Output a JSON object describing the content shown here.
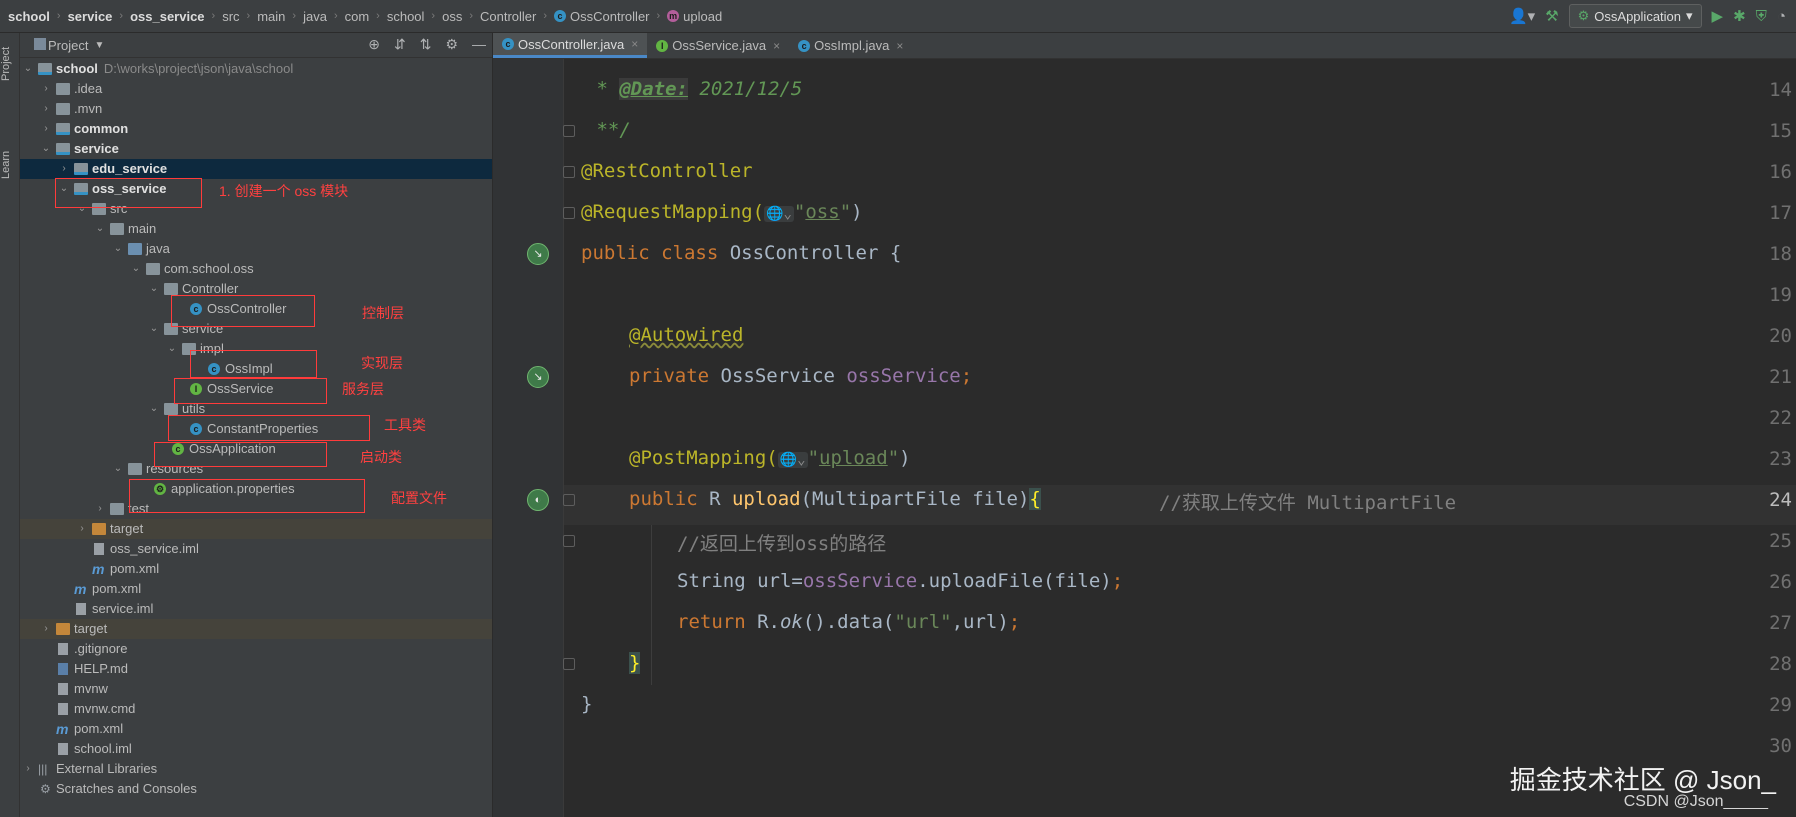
{
  "breadcrumb": [
    {
      "label": "school",
      "bold": true
    },
    {
      "label": "service",
      "bold": true
    },
    {
      "label": "oss_service",
      "bold": true
    },
    {
      "label": "src"
    },
    {
      "label": "main"
    },
    {
      "label": "java"
    },
    {
      "label": "com"
    },
    {
      "label": "school"
    },
    {
      "label": "oss"
    },
    {
      "label": "Controller"
    },
    {
      "label": "OssController",
      "icon": "class-icon"
    },
    {
      "label": "upload",
      "icon": "method-icon"
    }
  ],
  "run_config": {
    "label": "OssApplication"
  },
  "left_strip": {
    "project": "Project",
    "learn": "Learn"
  },
  "project_panel": {
    "title": "Project"
  },
  "tree": [
    {
      "label": "school",
      "path": "D:\\works\\project\\json\\java\\school",
      "bold": true
    },
    {
      "label": ".idea"
    },
    {
      "label": ".mvn"
    },
    {
      "label": "common",
      "bold": true
    },
    {
      "label": "service",
      "bold": true
    },
    {
      "label": "edu_service",
      "bold": true
    },
    {
      "label": "oss_service",
      "bold": true
    },
    {
      "label": "src"
    },
    {
      "label": "main"
    },
    {
      "label": "java"
    },
    {
      "label": "com.school.oss"
    },
    {
      "label": "Controller"
    },
    {
      "label": "OssController"
    },
    {
      "label": "service"
    },
    {
      "label": "impl"
    },
    {
      "label": "OssImpl"
    },
    {
      "label": "OssService"
    },
    {
      "label": "utils"
    },
    {
      "label": "ConstantProperties"
    },
    {
      "label": "OssApplication"
    },
    {
      "label": "resources"
    },
    {
      "label": "application.properties"
    },
    {
      "label": "test"
    },
    {
      "label": "target"
    },
    {
      "label": "oss_service.iml"
    },
    {
      "label": "pom.xml"
    },
    {
      "label": "pom.xml"
    },
    {
      "label": "service.iml"
    },
    {
      "label": "target"
    },
    {
      "label": ".gitignore"
    },
    {
      "label": "HELP.md"
    },
    {
      "label": "mvnw"
    },
    {
      "label": "mvnw.cmd"
    },
    {
      "label": "pom.xml"
    },
    {
      "label": "school.iml"
    },
    {
      "label": "External Libraries"
    },
    {
      "label": "Scratches and Consoles"
    }
  ],
  "annotations": {
    "module": "1. 创建一个 oss 模块",
    "controller": "控制层",
    "impl": "实现层",
    "service": "服务层",
    "utils": "工具类",
    "boot": "启动类",
    "config": "配置文件"
  },
  "tabs": [
    {
      "label": "OssController.java",
      "icon": "class-icon",
      "active": true
    },
    {
      "label": "OssService.java",
      "icon": "interface-icon"
    },
    {
      "label": "OssImpl.java",
      "icon": "class-icon"
    }
  ],
  "line_numbers": [
    "14",
    "15",
    "16",
    "17",
    "18",
    "19",
    "20",
    "21",
    "22",
    "23",
    "24",
    "25",
    "26",
    "27",
    "28",
    "29",
    "30"
  ],
  "code": {
    "l14_star": " * ",
    "l14_tag": "@Date:",
    "l14_val": " 2021/12/5",
    "l15": " **/",
    "l16": "@RestController",
    "l17_a": "@RequestMapping(",
    "l17_q1": "\"",
    "l17_s": "oss",
    "l17_q2": "\"",
    "l17_b": ")",
    "l18_kw": "public class ",
    "l18_name": "OssController {",
    "l20": "@Autowired",
    "l21_kw": "private ",
    "l21_type": "OssService ",
    "l21_field": "ossService",
    "l21_end": ";",
    "l23_a": "@PostMapping(",
    "l23_q1": "\"",
    "l23_s": "upload",
    "l23_q2": "\"",
    "l23_b": ")",
    "l24_kw": "public ",
    "l24_type": "R ",
    "l24_fn": "upload",
    "l24_params": "(MultipartFile file)",
    "l24_brace": "{",
    "l24_comment": "//获取上传文件 MultipartFile",
    "l25": "//返回上传到oss的路径",
    "l26_a": "String url=",
    "l26_field": "ossService",
    "l26_b": ".uploadFile(file)",
    "l26_end": ";",
    "l27_kw": "return ",
    "l27_a": "R.",
    "l27_ok": "ok",
    "l27_b": "().data(",
    "l27_s": "\"url\"",
    "l27_c": ",url)",
    "l27_end": ";",
    "l28": "}",
    "l29": "}"
  },
  "watermark": {
    "main": "掘金技术社区 @ Json_",
    "sub": "CSDN @Json_____"
  }
}
